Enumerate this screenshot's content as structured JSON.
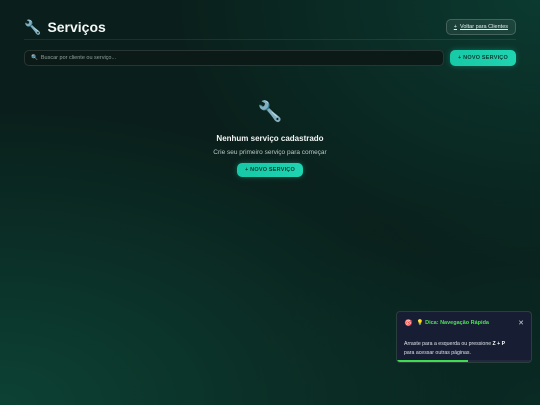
{
  "header": {
    "icon": "wrench-icon",
    "icon_glyph": "🔧",
    "title": "Serviços",
    "back_button": {
      "icon": "plus-icon",
      "icon_glyph": "+",
      "label": "Voltar para Clientes"
    }
  },
  "search": {
    "icon": "search-icon",
    "icon_glyph": "🔍",
    "placeholder": "Buscar por cliente ou serviço...",
    "value": ""
  },
  "new_service_button": "+ NOVO SERVIÇO",
  "empty_state": {
    "icon": "wrench-icon",
    "icon_glyph": "🔧",
    "title": "Nenhum serviço cadastrado",
    "subtitle": "Crie seu primeiro serviço para começar",
    "button": "+ NOVO SERVIÇO"
  },
  "toast": {
    "icon": "target-icon",
    "icon_glyph": "🎯",
    "title": "💡 Dica: Navegação Rápida",
    "close_glyph": "✕",
    "body_prefix": "Arraste para a esquerda ou pressione ",
    "shortcut": "Z + P",
    "body_suffix": " para acessar outras páginas.",
    "progress": 0.53
  },
  "colors": {
    "accent": "#1fd4b1",
    "toast_title": "#4ee05a",
    "progress": "#3ddc52",
    "background": "#0a1f1b"
  }
}
